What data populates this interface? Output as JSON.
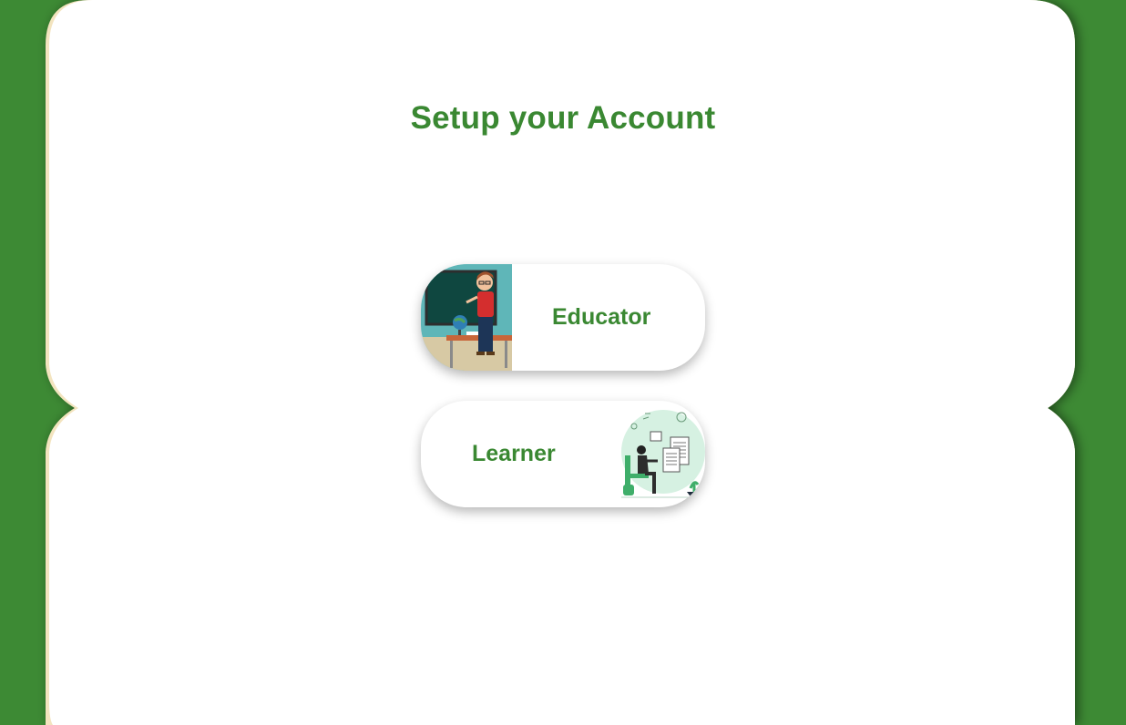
{
  "page": {
    "title": "Setup your Account"
  },
  "roles": [
    {
      "label": "Educator",
      "illustration": "teacher-at-blackboard-illustration"
    },
    {
      "label": "Learner",
      "illustration": "student-studying-illustration"
    }
  ],
  "colors": {
    "background": "#3d8a34",
    "panel": "#ffffff",
    "accent_text": "#3a8832",
    "panel_edge": "#f3e4bf"
  }
}
